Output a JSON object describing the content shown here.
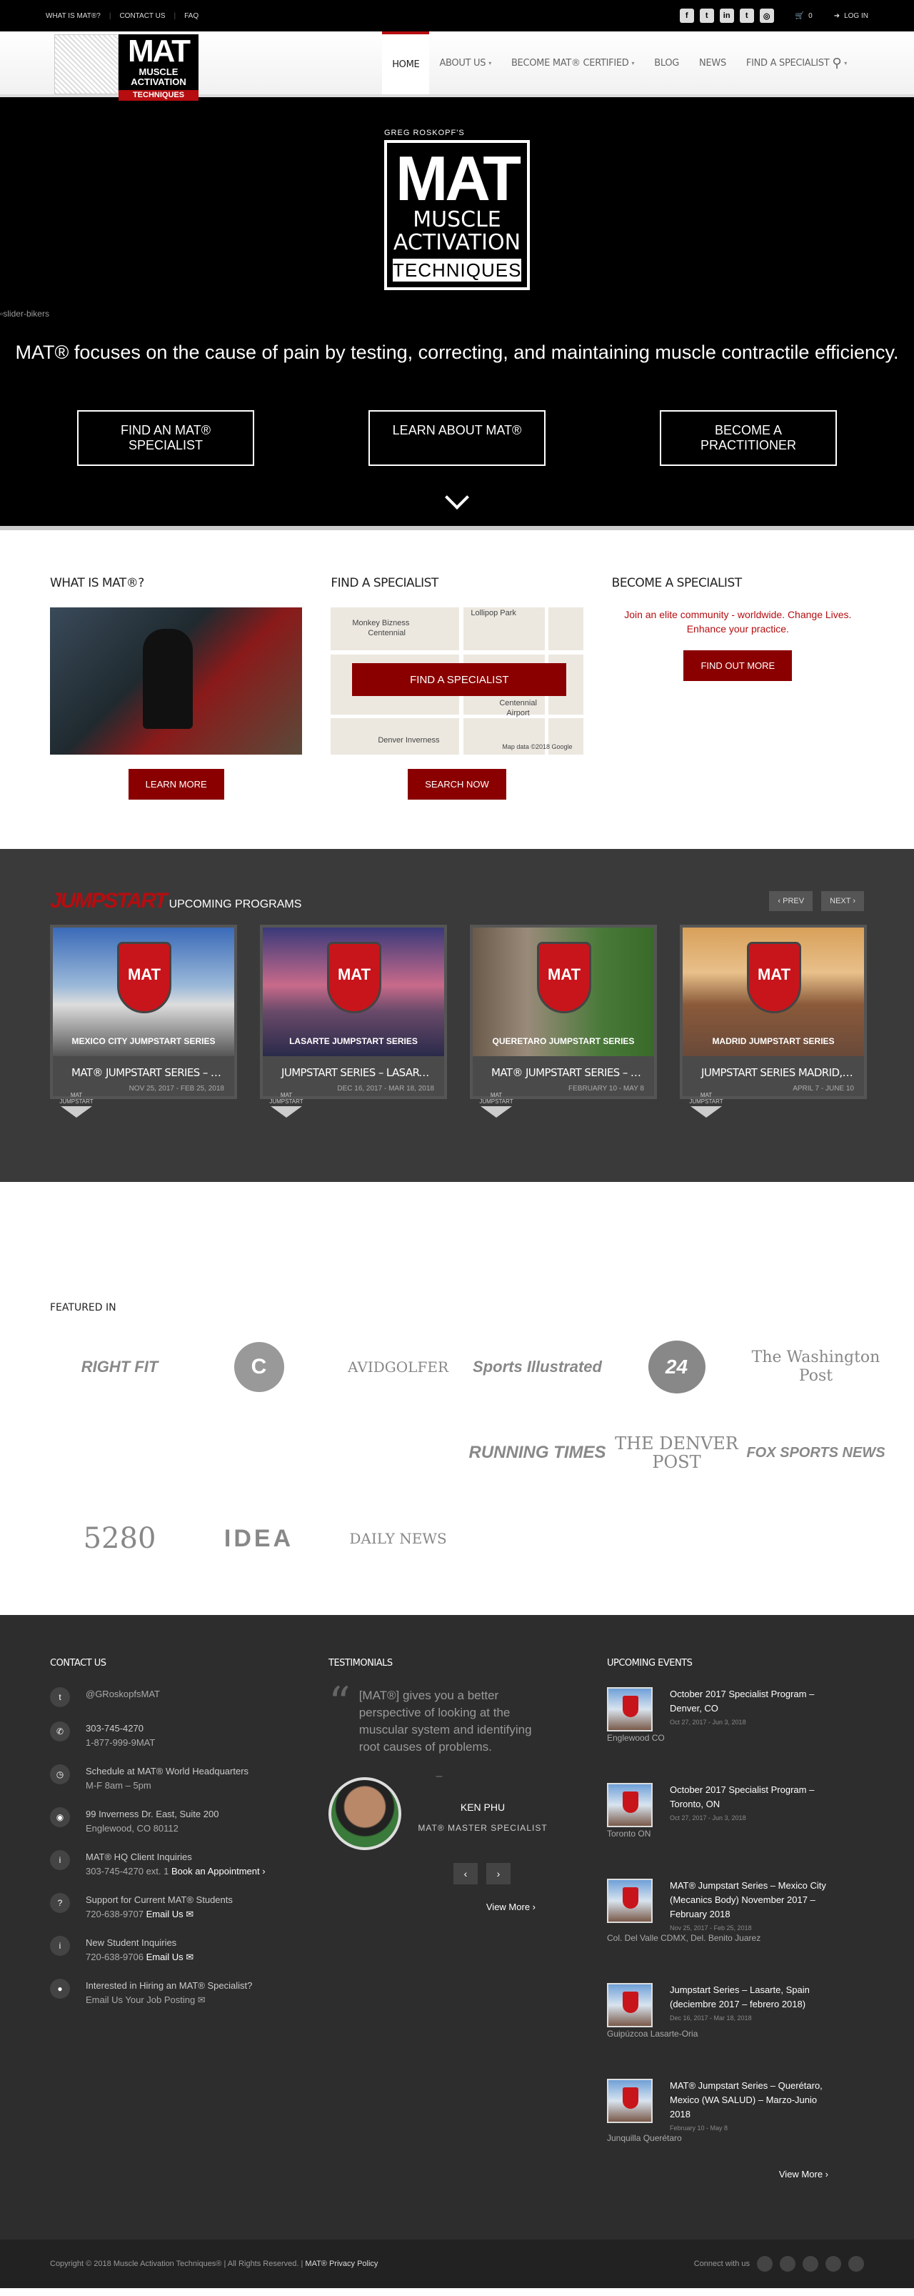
{
  "topbar": {
    "links": [
      "WHAT IS MAT®?",
      "CONTACT US",
      "FAQ"
    ],
    "social": [
      {
        "icon": "facebook-icon",
        "glyph": "f"
      },
      {
        "icon": "twitter-icon",
        "glyph": "t"
      },
      {
        "icon": "linkedin-icon",
        "glyph": "in"
      },
      {
        "icon": "tumblr-icon",
        "glyph": "t"
      },
      {
        "icon": "instagram-icon",
        "glyph": "◎"
      }
    ],
    "cart_count": "0",
    "login": "LOG IN"
  },
  "logo": {
    "big": "MAT",
    "line1": "MUSCLE",
    "line2": "ACTIVATION",
    "line3": "TECHNIQUES"
  },
  "nav": {
    "items": [
      "HOME",
      "ABOUT US",
      "BECOME MAT® CERTIFIED",
      "BLOG",
      "NEWS",
      "FIND A SPECIALIST"
    ]
  },
  "hero": {
    "byline": "GREG ROSKOPF'S",
    "broken_img": "slider-bikers",
    "tagline": "MAT® focuses on the cause of pain by testing, correcting, and maintaining muscle contractile efficiency.",
    "buttons": [
      "FIND AN MAT® SPECIALIST",
      "LEARN ABOUT MAT®",
      "BECOME A PRACTITIONER"
    ]
  },
  "columns": {
    "what": {
      "title": "WHAT IS MAT®?",
      "button": "LEARN MORE"
    },
    "find": {
      "title": "FIND A SPECIALIST",
      "map_button": "FIND A SPECIALIST",
      "button": "SEARCH NOW",
      "map_labels": [
        "Lollipop Park",
        "Monkey Bizness",
        "Centennial",
        "Centennial",
        "Airport",
        "Denver Inverness",
        "Map data ©2018 Google"
      ]
    },
    "become": {
      "title": "BECOME A SPECIALIST",
      "text": "Join an elite community - worldwide. Change Lives. Enhance your practice.",
      "button": "FIND OUT MORE"
    }
  },
  "jumpstart": {
    "logo": "JUMPSTART",
    "title": "UPCOMING PROGRAMS",
    "prev": "PREV",
    "next": "NEXT",
    "badge": "MAT JUMPSTART",
    "cards": [
      {
        "caption": "MEXICO CITY JUMPSTART SERIES",
        "title": "MAT® JUMPSTART SERIES – MEXIC...",
        "date": "NOV 25, 2017 - FEB 25, 2018",
        "bg": "linear-gradient(#3a6ab8, #9ab8d8 45%, #ddd 60%, #555)"
      },
      {
        "caption": "LASARTE JUMPSTART SERIES",
        "title": "JUMPSTART SERIES – LASARTE, SPAI...",
        "date": "DEC 16, 2017 - MAR 18, 2018",
        "bg": "linear-gradient(#3a3a7a, #c86a8a 45%, #6a4a6a 65%, #2a2a4a)"
      },
      {
        "caption": "QUERETARO JUMPSTART SERIES",
        "title": "MAT® JUMPSTART SERIES – QUERE...",
        "date": "FEBRUARY 10 - MAY 8",
        "bg": "linear-gradient(90deg, #6a5a4a, #9a8a7a 30%, #4a7a3a 70%, #3a6a2a)"
      },
      {
        "caption": "MADRID JUMPSTART SERIES",
        "title": "JUMPSTART SERIES MADRID, SPAIN (...",
        "date": "APRIL 7 - JUNE 10",
        "bg": "linear-gradient(#d8a05a, #e8c08a 35%, #8a5a3a 60%, #6a4a3a)"
      }
    ]
  },
  "featured": {
    "title": "FEATURED IN",
    "logos": [
      "RIGHT FIT",
      "C",
      "AVIDGOLFER",
      "Sports Illustrated",
      "24",
      "The Washington Post",
      "RUNNING TIMES",
      "THE DENVER POST",
      "FOX SPORTS NEWS",
      "5280",
      "IDEA",
      "DAILY NEWS"
    ]
  },
  "footer": {
    "contact": {
      "title": "CONTACT US",
      "rows": [
        {
          "icon": "twitter-icon",
          "glyph": "t",
          "lines": [
            "@GRoskopfsMAT"
          ]
        },
        {
          "icon": "phone-icon",
          "glyph": "✆",
          "lines": [
            "303-745-4270",
            "1-877-999-9MAT"
          ]
        },
        {
          "icon": "clock-icon",
          "glyph": "◷",
          "lines": [
            "Schedule at MAT® World Headquarters",
            "M-F 8am – 5pm"
          ]
        },
        {
          "icon": "location-icon",
          "glyph": "◉",
          "lines": [
            "99 Inverness Dr. East, Suite 200",
            "Englewood, CO 80112"
          ]
        },
        {
          "icon": "info-icon",
          "glyph": "i",
          "lines": [
            "MAT® HQ Client Inquiries",
            "303-745-4270 ext. 1"
          ],
          "link": "Book an Appointment ›"
        },
        {
          "icon": "question-icon",
          "glyph": "?",
          "lines": [
            "Support for Current MAT® Students",
            "720-638-9707"
          ],
          "link": "Email Us ✉"
        },
        {
          "icon": "info-icon",
          "glyph": "i",
          "lines": [
            "New Student Inquiries",
            "720-638-9706"
          ],
          "link": "Email Us ✉"
        },
        {
          "icon": "dot-icon",
          "glyph": "●",
          "lines": [
            "Interested in Hiring an MAT® Specialist?",
            "Email Us Your Job Posting ✉"
          ]
        }
      ]
    },
    "testimonials": {
      "title": "TESTIMONIALS",
      "quote": "[MAT®] gives you a better perspective of looking at the muscular system and identifying root causes of problems.",
      "dash": "–",
      "name": "KEN PHU",
      "role": "MAT® MASTER SPECIALIST",
      "view_more": "View More ›"
    },
    "events": {
      "title": "UPCOMING EVENTS",
      "items": [
        {
          "title": "October 2017 Specialist Program – Denver, CO",
          "date": "Oct 27, 2017 - Jun 3, 2018",
          "loc": "Englewood CO"
        },
        {
          "title": "October 2017 Specialist Program – Toronto, ON",
          "date": "Oct 27, 2017 - Jun 3, 2018",
          "loc": "Toronto ON"
        },
        {
          "title": "MAT® Jumpstart Series – Mexico City (Mecanics Body) November 2017 – February 2018",
          "date": "Nov 25, 2017 - Feb 25, 2018",
          "loc": "Col. Del Valle CDMX, Del. Benito Juarez"
        },
        {
          "title": "Jumpstart Series – Lasarte, Spain (deciembre 2017 – febrero 2018)",
          "date": "Dec 16, 2017 - Mar 18, 2018",
          "loc": "Guipúzcoa Lasarte-Oria"
        },
        {
          "title": "MAT® Jumpstart Series – Querétaro, Mexico (WA SALUD) – Marzo-Junio 2018",
          "date": "February 10 - May 8",
          "loc": "Junquilla Querétaro"
        }
      ],
      "view_more": "View More ›"
    }
  },
  "bottom": {
    "copyright": "Copyright © 2018 Muscle Activation Techniques® | All Rights Reserved. |",
    "privacy": "MAT® Privacy Policy",
    "connect": "Connect with us"
  }
}
